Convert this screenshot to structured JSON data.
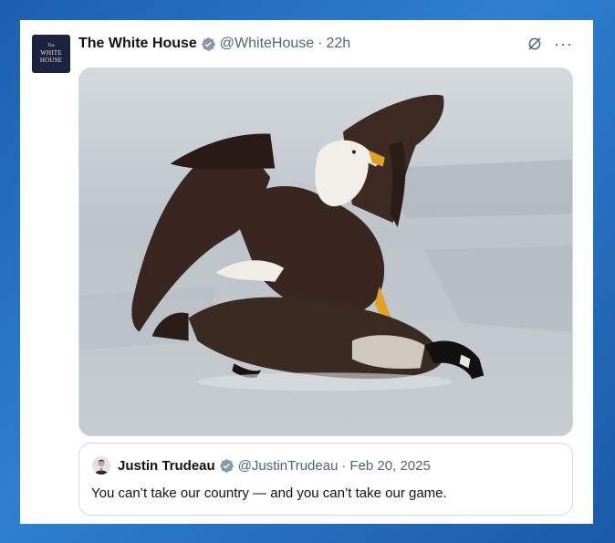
{
  "post": {
    "author_name": "The White House",
    "handle": "@WhiteHouse",
    "separator": "·",
    "time": "22h",
    "avatar": {
      "line1": "The",
      "line2": "WHITE",
      "line3": "HOUSE"
    },
    "verified_color": "#829aab",
    "icons": [
      "grok-icon",
      "more-options-icon"
    ],
    "more_label": "···"
  },
  "quoted_post": {
    "author_name": "Justin Trudeau",
    "handle": "@JustinTrudeau",
    "separator": "·",
    "date": "Feb 20, 2025",
    "text": "You can’t take our country — and you can’t take our game."
  },
  "colors": {
    "background": "#2f7fd0",
    "card": "#ffffff",
    "text_primary": "#0f1419",
    "text_secondary": "#536471"
  }
}
